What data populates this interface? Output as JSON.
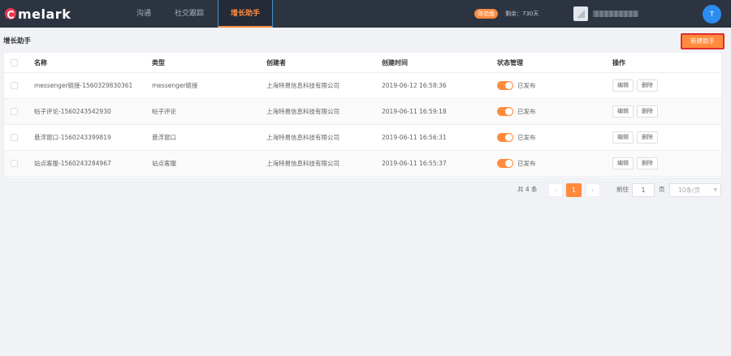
{
  "app": {
    "logo_text": "melark"
  },
  "nav": {
    "items": [
      {
        "label": "沟通"
      },
      {
        "label": "社交跟踪"
      },
      {
        "label": "增长助手"
      }
    ],
    "active_index": 2
  },
  "account": {
    "trial_badge": "体验版",
    "remaining": "剩余：730天",
    "avatar_initial": "T"
  },
  "page": {
    "title": "增长助手",
    "create_button": "新建助手"
  },
  "table": {
    "columns": [
      "名称",
      "类型",
      "创建者",
      "创建时间",
      "状态管理",
      "操作"
    ],
    "rows": [
      {
        "name": "messenger链接-1560329830361",
        "type": "messenger链接",
        "creator": "上海特易信息科技有限公司",
        "created": "2019-06-12 16:58:36",
        "status": "已发布"
      },
      {
        "name": "帖子评论-1560243542930",
        "type": "帖子评论",
        "creator": "上海特易信息科技有限公司",
        "created": "2019-06-11 16:59:18",
        "status": "已发布"
      },
      {
        "name": "悬浮窗口-1560243399819",
        "type": "悬浮窗口",
        "creator": "上海特易信息科技有限公司",
        "created": "2019-06-11 16:56:31",
        "status": "已发布"
      },
      {
        "name": "站点客服-1560243284967",
        "type": "站点客服",
        "creator": "上海特易信息科技有限公司",
        "created": "2019-06-11 16:55:37",
        "status": "已发布"
      }
    ],
    "actions": {
      "edit": "编辑",
      "delete": "删除"
    }
  },
  "pagination": {
    "total": "共 4 条",
    "prev": "‹",
    "next": "›",
    "current_page": "1",
    "goto_label": "前往",
    "goto_value": "1",
    "page_label": "页",
    "page_size": "10条/页"
  },
  "colors": {
    "accent": "#ff8a3d",
    "topbar": "#2c3442",
    "avatar": "#2d8cf0"
  }
}
